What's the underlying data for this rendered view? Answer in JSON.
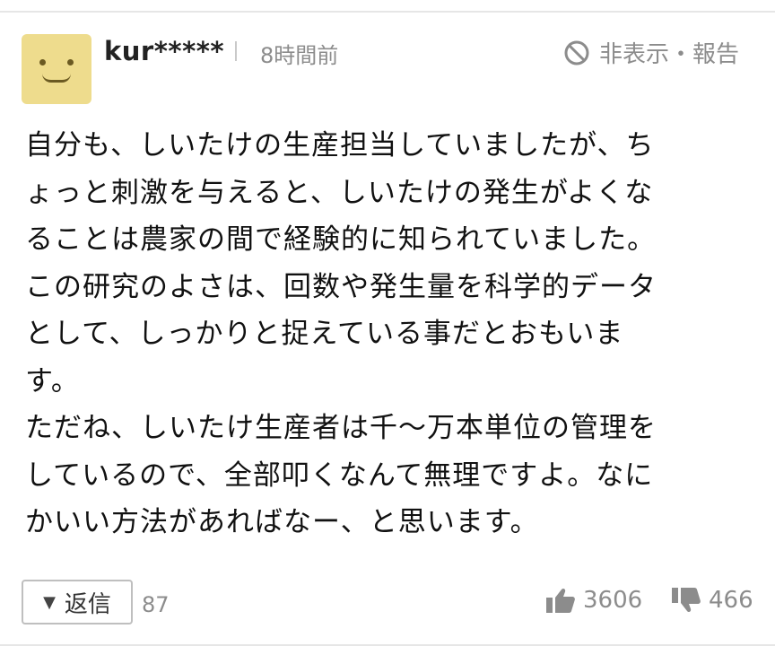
{
  "comment": {
    "username": "kur*****",
    "time": "8時間前",
    "hide_report": "非表示・報告",
    "body": "自分も、しいたけの生産担当していましたが、ち\nょっと刺激を与えると、しいたけの発生がよくな\nることは農家の間で経験的に知られていました。\nこの研究のよさは、回数や発生量を科学的データ\nとして、しっかりと捉えている事だとおもいま\nす。\nただね、しいたけ生産者は千〜万本単位の管理を\nしているので、全部叩くなんて無理ですよ。なに\nかいい方法があればなー、と思います。",
    "reply_label": "返信",
    "reply_count": "87",
    "likes": "3606",
    "dislikes": "466"
  },
  "icons": {
    "avatar": "smiley-avatar-icon",
    "hide": "block-icon",
    "reply_toggle": "triangle-down-icon",
    "like": "thumbs-up-icon",
    "dislike": "thumbs-down-icon"
  },
  "colors": {
    "avatar_bg": "#eedc8d",
    "muted_text": "#8c8c8c",
    "main_text": "#111111"
  }
}
